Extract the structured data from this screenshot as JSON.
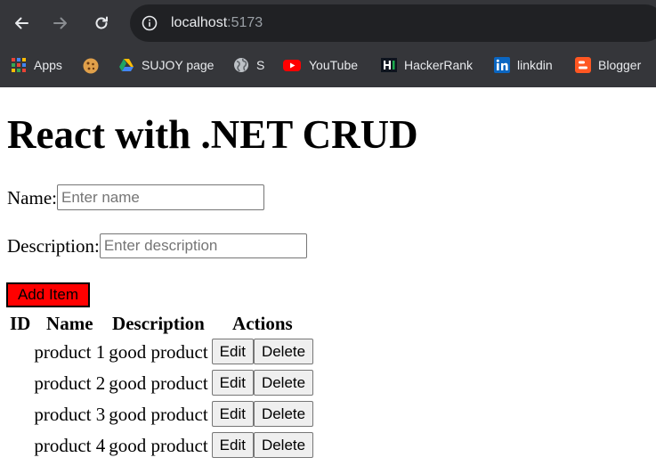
{
  "browser": {
    "url_host": "localhost",
    "url_port": ":5173",
    "bookmarks": [
      {
        "label": "Apps",
        "icon": "apps-grid-icon"
      },
      {
        "label": "",
        "icon": "cookie-icon"
      },
      {
        "label": "SUJOY page",
        "icon": "google-drive-icon"
      },
      {
        "label": "S",
        "icon": "globe-icon"
      },
      {
        "label": "YouTube",
        "icon": "youtube-icon"
      },
      {
        "label": "HackerRank",
        "icon": "hackerrank-icon"
      },
      {
        "label": "linkdin",
        "icon": "linkedin-icon"
      },
      {
        "label": "Blogger",
        "icon": "blogger-icon"
      }
    ]
  },
  "page": {
    "title": "React with .NET CRUD",
    "form": {
      "name_label": "Name:",
      "name_placeholder": "Enter name",
      "name_value": "",
      "description_label": "Description:",
      "description_placeholder": "Enter description",
      "description_value": "",
      "add_button": "Add Item"
    },
    "table": {
      "headers": [
        "ID",
        "Name",
        "Description",
        "Actions"
      ],
      "rows": [
        {
          "id": "",
          "name": "product 1",
          "description": "good product",
          "edit": "Edit",
          "delete": "Delete"
        },
        {
          "id": "",
          "name": "product 2",
          "description": "good product",
          "edit": "Edit",
          "delete": "Delete"
        },
        {
          "id": "",
          "name": "product 3",
          "description": "good product",
          "edit": "Edit",
          "delete": "Delete"
        },
        {
          "id": "",
          "name": "product 4",
          "description": "good product",
          "edit": "Edit",
          "delete": "Delete"
        }
      ]
    }
  },
  "colors": {
    "chrome_bg": "#35363a",
    "urlbar_bg": "#202124",
    "add_button_bg": "#ff0000"
  }
}
